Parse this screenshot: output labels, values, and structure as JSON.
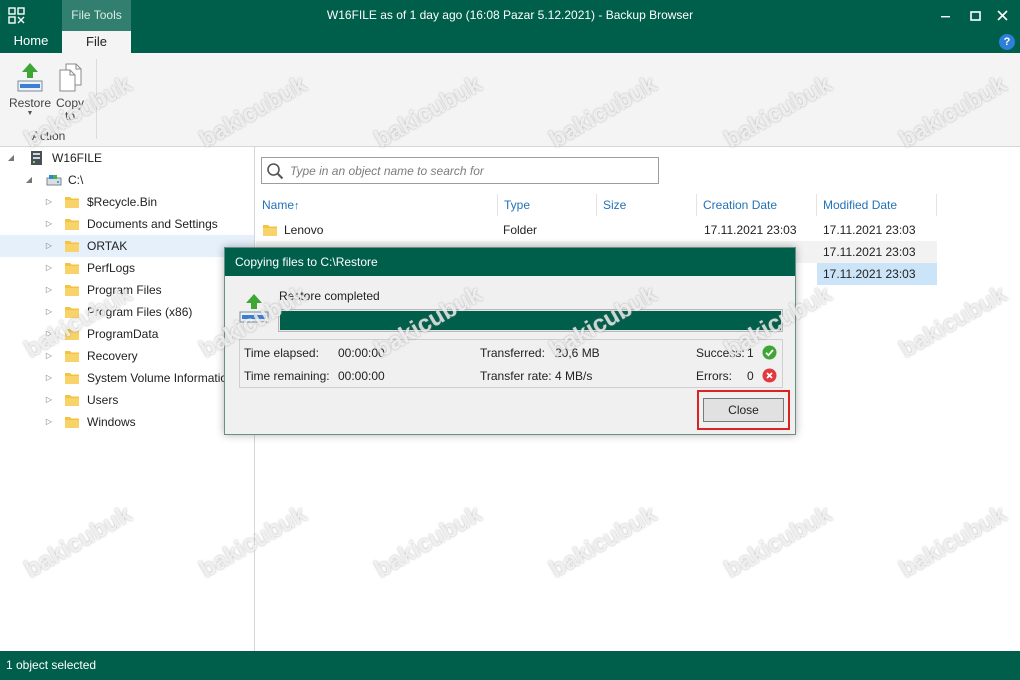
{
  "window": {
    "title": "W16FILE as of 1 day ago (16:08 Pazar 5.12.2021) - Backup Browser",
    "context_tab_group": "File Tools"
  },
  "ribbon": {
    "tabs": [
      "Home",
      "File"
    ],
    "active_tab": "File",
    "buttons": {
      "restore": {
        "label": "Restore",
        "icon": "restore-icon"
      },
      "copy_to": {
        "label_line1": "Copy",
        "label_line2": "to",
        "icon": "copy-icon"
      }
    },
    "group_label": "Action",
    "help": "?"
  },
  "tree": {
    "server": "W16FILE",
    "drive": "C:\\",
    "folders": [
      "$Recycle.Bin",
      "Documents and Settings",
      "ORTAK",
      "PerfLogs",
      "Program Files",
      "Program Files (x86)",
      "ProgramData",
      "Recovery",
      "System Volume Information",
      "Users",
      "Windows"
    ],
    "selected": "ORTAK"
  },
  "search": {
    "placeholder": "Type in an object name to search for"
  },
  "file_list": {
    "columns": [
      "Name",
      "Type",
      "Size",
      "Creation Date",
      "Modified Date"
    ],
    "sort_indicator": "↑",
    "rows": [
      {
        "name": "Lenovo",
        "type": "Folder",
        "size": "",
        "created": "17.11.2021 23:03",
        "modified": "17.11.2021 23:03"
      },
      {
        "name": "",
        "type": "",
        "size": "",
        "created": "",
        "modified": "17.11.2021 23:03"
      },
      {
        "name": "",
        "type": "",
        "size": "",
        "created": "",
        "modified": "17.11.2021 23:03"
      }
    ]
  },
  "dialog": {
    "title": "Copying files to C:\\Restore",
    "status": "Restore completed",
    "progress_percent": 100,
    "time_elapsed_label": "Time elapsed:",
    "time_elapsed": "00:00:00",
    "time_remaining_label": "Time remaining:",
    "time_remaining": "00:00:00",
    "transferred_label": "Transferred:",
    "transferred": "20,6 MB",
    "transfer_rate_label": "Transfer rate:",
    "transfer_rate": "4 MB/s",
    "success_label": "Success:",
    "success": "1",
    "errors_label": "Errors:",
    "errors": "0",
    "close_button": "Close"
  },
  "statusbar": {
    "text": "1 object selected"
  },
  "watermark": "bakicubuk",
  "colors": {
    "brand": "#005f4b",
    "link": "#2472b8",
    "success": "#3fa535",
    "error": "#e0393e",
    "highlight": "#d22222"
  }
}
